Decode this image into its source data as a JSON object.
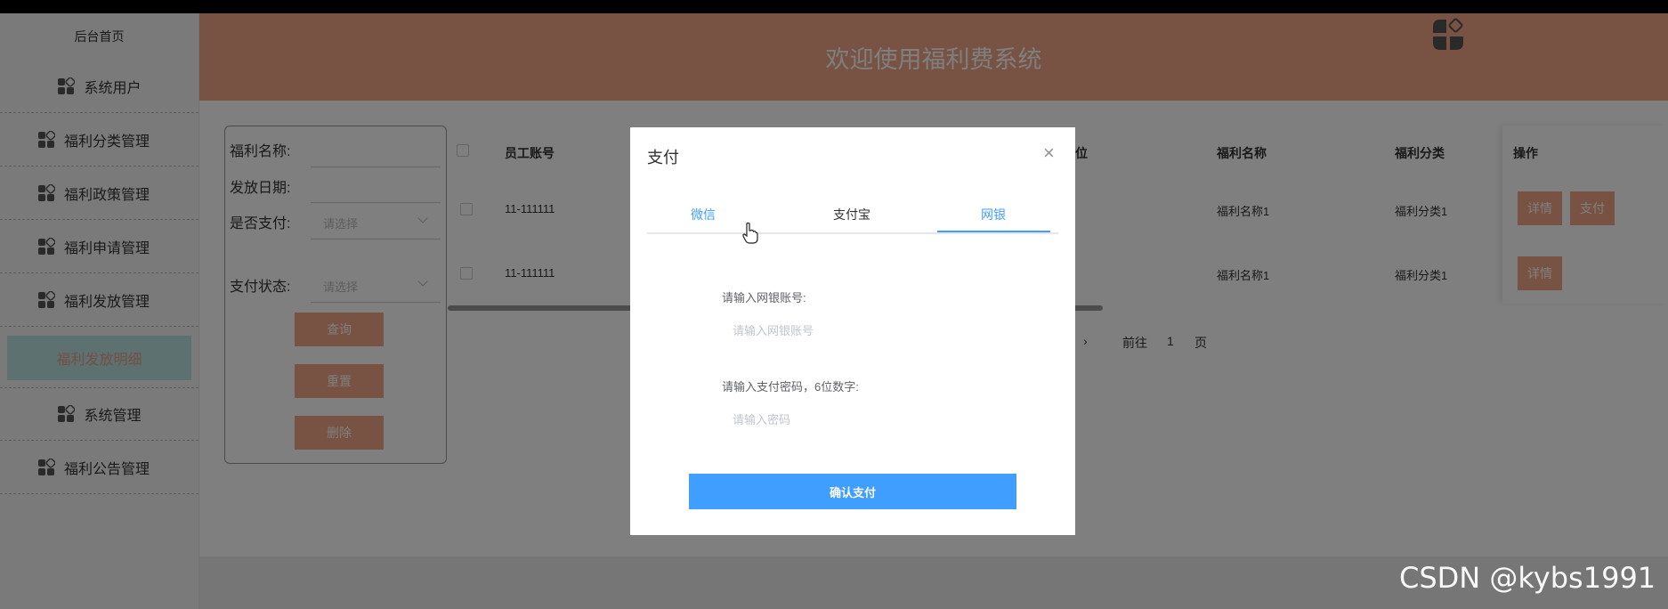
{
  "header": {
    "title": "欢迎使用福利费系统"
  },
  "sidebar": {
    "home": "后台首页",
    "items": [
      {
        "label": "系统用户",
        "align": "center"
      },
      {
        "label": "福利分类管理",
        "align": "left"
      },
      {
        "label": "福利政策管理",
        "align": "left"
      },
      {
        "label": "福利申请管理",
        "align": "left"
      },
      {
        "label": "福利发放管理",
        "align": "left"
      }
    ],
    "active": "福利发放明细",
    "items_after": [
      {
        "label": "系统管理",
        "align": "center"
      },
      {
        "label": "福利公告管理",
        "align": "left"
      }
    ]
  },
  "filter": {
    "name_label": "福利名称:",
    "date_label": "发放日期:",
    "paid_label": "是否支付:",
    "paid_placeholder": "请选择",
    "status_label": "支付状态:",
    "status_placeholder": "请选择",
    "query_btn": "查询",
    "reset_btn": "重置",
    "delete_btn": "删除"
  },
  "table": {
    "headers": {
      "account": "员工账号",
      "position": "位",
      "benefit_name": "福利名称",
      "benefit_category": "福利分类",
      "ops": "操作"
    },
    "rows": [
      {
        "account": "11-111111",
        "benefit_name": "福利名称1",
        "benefit_category": "福利分类1",
        "detail": "详情",
        "pay": "支付"
      },
      {
        "account": "11-111111",
        "benefit_name": "福利名称1",
        "benefit_category": "福利分类1",
        "detail": "详情"
      }
    ]
  },
  "pager": {
    "goto": "前往",
    "page": "1",
    "page_unit": "页"
  },
  "modal": {
    "title": "支付",
    "tabs": [
      "微信",
      "支付宝",
      "网银"
    ],
    "active_tab": "网银",
    "bank_label": "请输入网银账号:",
    "bank_placeholder": "请输入网银账号",
    "pwd_label": "请输入支付密码，6位数字:",
    "pwd_placeholder": "请输入密码",
    "confirm": "确认支付"
  },
  "watermark": "CSDN @kybs1991"
}
